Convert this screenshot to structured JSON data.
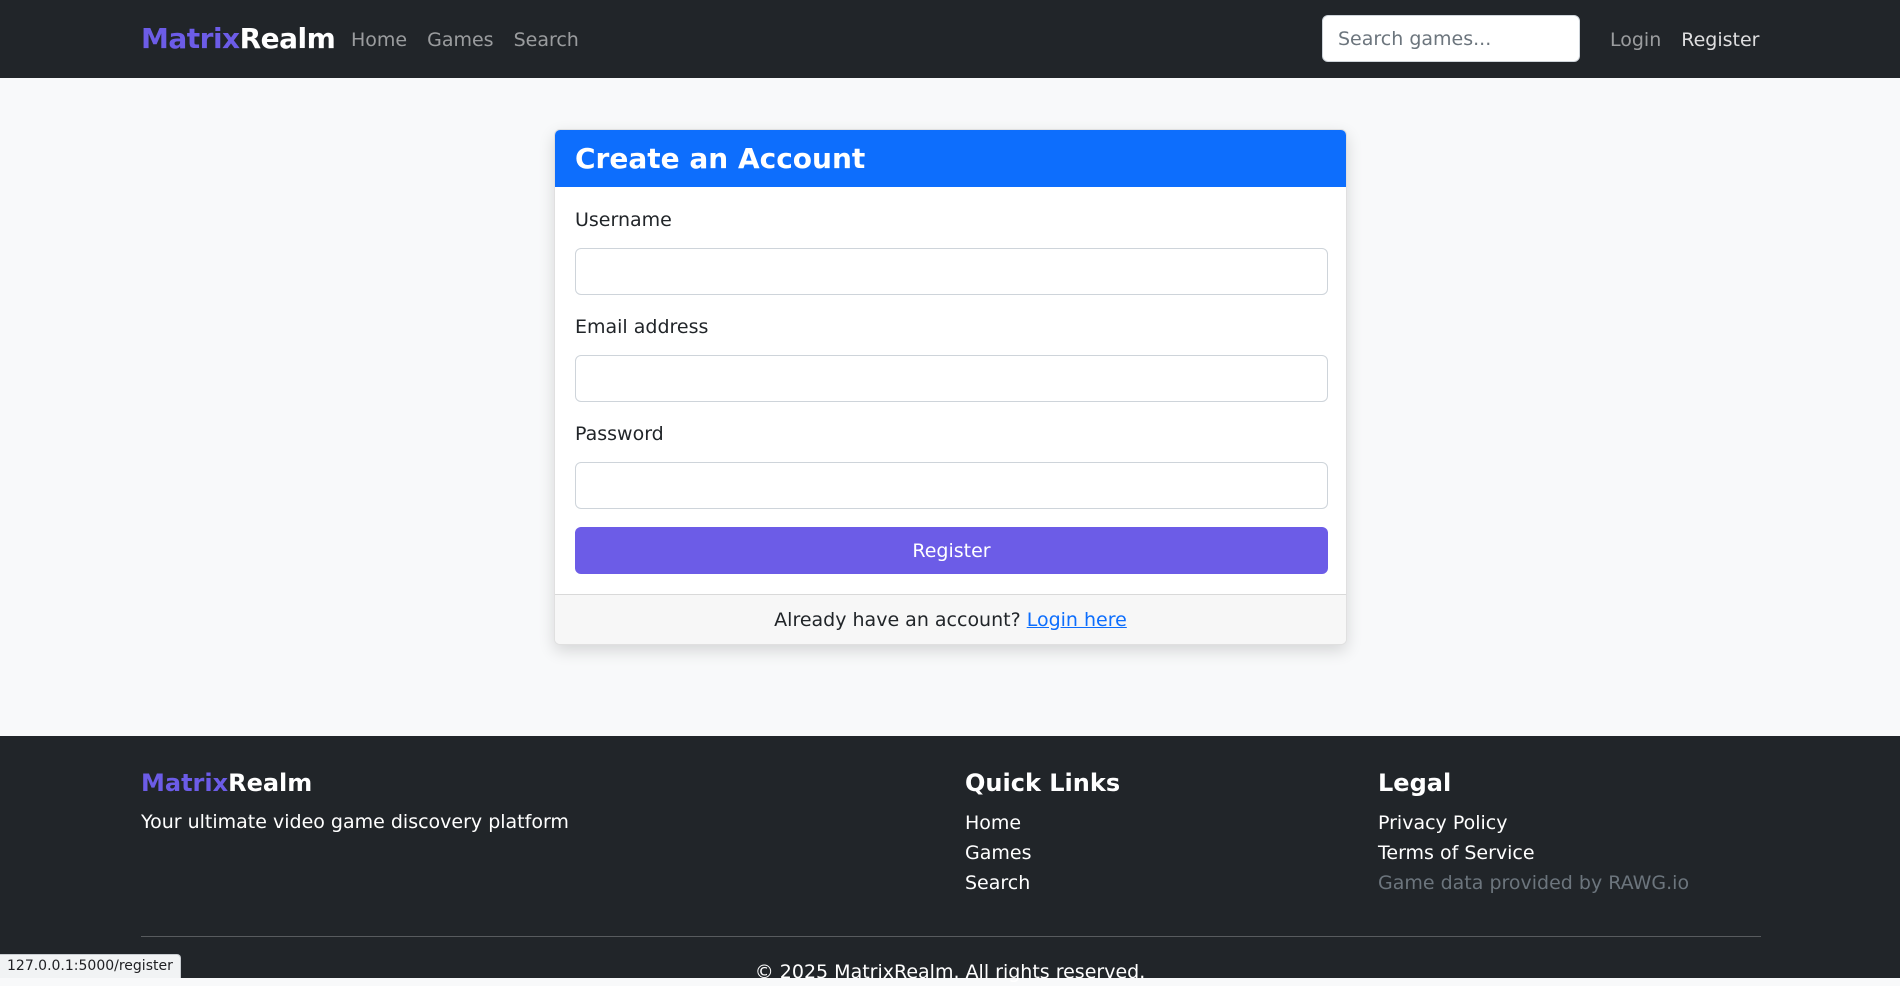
{
  "navbar": {
    "brand_part1": "Matrix",
    "brand_part2": "Realm",
    "links": [
      "Home",
      "Games",
      "Search"
    ],
    "search_placeholder": "Search games...",
    "login": "Login",
    "register": "Register"
  },
  "form": {
    "title": "Create an Account",
    "username_label": "Username",
    "email_label": "Email address",
    "password_label": "Password",
    "submit": "Register",
    "footer_text": "Already have an account?",
    "footer_link": "Login here"
  },
  "footer": {
    "brand_part1": "Matrix",
    "brand_part2": "Realm",
    "tagline": "Your ultimate video game discovery platform",
    "quick_links_title": "Quick Links",
    "quick_links": [
      "Home",
      "Games",
      "Search"
    ],
    "legal_title": "Legal",
    "legal_links": [
      "Privacy Policy",
      "Terms of Service"
    ],
    "data_note": "Game data provided by RAWG.io",
    "copyright": "© 2025 MatrixRealm. All rights reserved."
  },
  "status_bar": {
    "url": "127.0.0.1:5000/register"
  },
  "colors": {
    "brand_accent": "#6c5ce7",
    "header_blue": "#0d6efd",
    "dark": "#212529"
  }
}
